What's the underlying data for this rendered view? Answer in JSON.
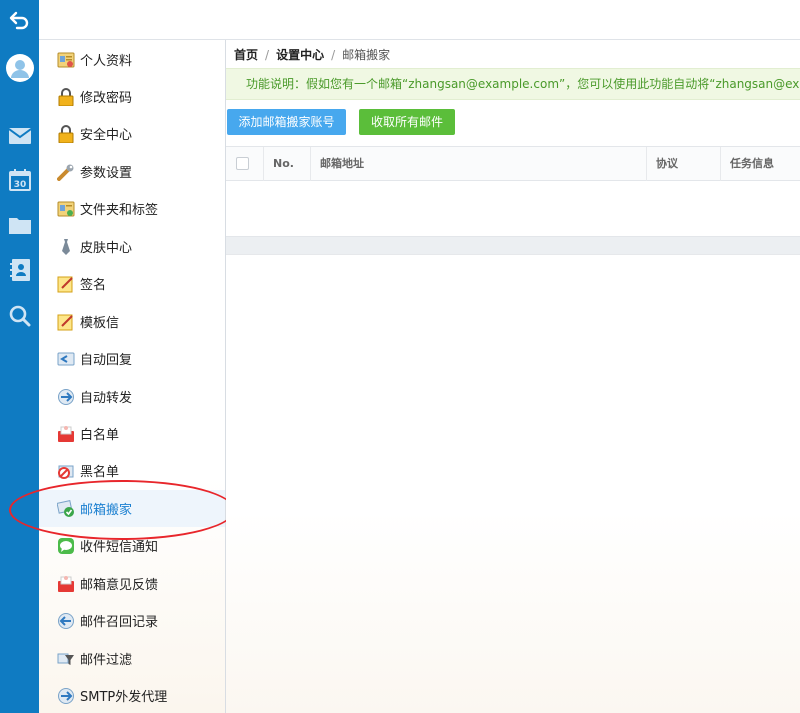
{
  "rail": {
    "icons": [
      "back-icon",
      "avatar-icon",
      "mail-icon",
      "calendar-icon",
      "folder-icon",
      "contacts-icon",
      "search-icon"
    ],
    "calendar_day": "30"
  },
  "sidebar": {
    "items": [
      {
        "label": "个人资料",
        "icon": "profile-card-icon"
      },
      {
        "label": "修改密码",
        "icon": "lock-icon"
      },
      {
        "label": "安全中心",
        "icon": "lock-icon"
      },
      {
        "label": "参数设置",
        "icon": "wrench-icon"
      },
      {
        "label": "文件夹和标签",
        "icon": "folder-tag-icon"
      },
      {
        "label": "皮肤中心",
        "icon": "tie-icon"
      },
      {
        "label": "签名",
        "icon": "note-pen-icon"
      },
      {
        "label": "模板信",
        "icon": "note-pen-icon"
      },
      {
        "label": "自动回复",
        "icon": "auto-reply-icon"
      },
      {
        "label": "自动转发",
        "icon": "forward-icon"
      },
      {
        "label": "白名单",
        "icon": "mailbox-white-icon"
      },
      {
        "label": "黑名单",
        "icon": "block-icon"
      },
      {
        "label": "邮箱搬家",
        "icon": "mail-move-icon"
      },
      {
        "label": "收件短信通知",
        "icon": "sms-icon"
      },
      {
        "label": "邮箱意见反馈",
        "icon": "feedback-icon"
      },
      {
        "label": "邮件召回记录",
        "icon": "recall-icon"
      },
      {
        "label": "邮件过滤",
        "icon": "filter-icon"
      },
      {
        "label": "SMTP外发代理",
        "icon": "smtp-icon"
      }
    ],
    "active_index": 12
  },
  "breadcrumb": {
    "home": "首页",
    "sep1": "/",
    "settings": "设置中心",
    "sep2": "/",
    "current": "邮箱搬家"
  },
  "info": {
    "text": "功能说明：假如您有一个邮箱“zhangsan@example.com”，您可以使用此功能自动将“zhangsan@example.com”"
  },
  "buttons": {
    "add": "添加邮箱搬家账号",
    "fetch": "收取所有邮件"
  },
  "table": {
    "columns": [
      "No.",
      "邮箱地址",
      "协议",
      "任务信息"
    ]
  },
  "colors": {
    "rail": "#0f7bc2",
    "add_button": "#47a8ee",
    "fetch_button": "#5bbe3a",
    "info_text": "#4a9a2a",
    "info_bg": "#f0f8e3",
    "active_link": "#1a7fd0",
    "annotation": "#e8262b"
  }
}
